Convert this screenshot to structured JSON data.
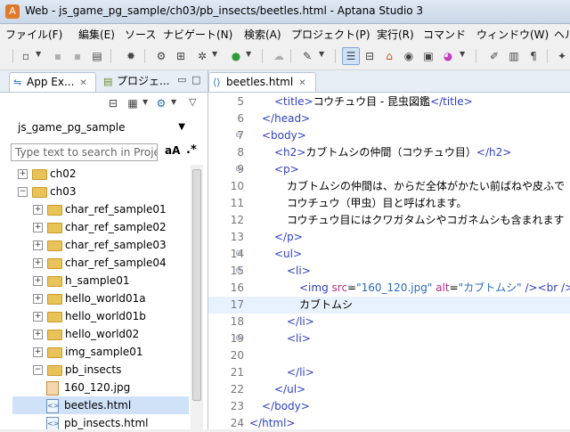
{
  "window": {
    "title": "Web - js_game_pg_sample/ch03/pb_insects/beetles.html - Aptana Studio 3"
  },
  "menu": [
    "ファイル(F)",
    "編集(E)",
    "ソース",
    "ナビゲート(N)",
    "検索(A)",
    "プロジェクト(P)",
    "実行(R)",
    "コマンド",
    "ウィンドウ(W)",
    "ヘル"
  ],
  "left_panel": {
    "tabs": [
      {
        "label": "App Ex..."
      },
      {
        "label": "プロジェ..."
      }
    ],
    "project": "js_game_pg_sample",
    "search_placeholder": "Type text to search in Project",
    "aa_label": "aA",
    "regex_label": ".*",
    "tree": [
      {
        "label": "ch02",
        "type": "folder",
        "level": 0,
        "expander": "+"
      },
      {
        "label": "ch03",
        "type": "folder",
        "level": 0,
        "expander": "−"
      },
      {
        "label": "char_ref_sample01",
        "type": "folder",
        "level": 1,
        "expander": "+"
      },
      {
        "label": "char_ref_sample02",
        "type": "folder",
        "level": 1,
        "expander": "+"
      },
      {
        "label": "char_ref_sample03",
        "type": "folder",
        "level": 1,
        "expander": "+"
      },
      {
        "label": "char_ref_sample04",
        "type": "folder",
        "level": 1,
        "expander": "+"
      },
      {
        "label": "h_sample01",
        "type": "folder",
        "level": 1,
        "expander": "+"
      },
      {
        "label": "hello_world01a",
        "type": "folder",
        "level": 1,
        "expander": "+"
      },
      {
        "label": "hello_world01b",
        "type": "folder",
        "level": 1,
        "expander": "+"
      },
      {
        "label": "hello_world02",
        "type": "folder",
        "level": 1,
        "expander": "+"
      },
      {
        "label": "img_sample01",
        "type": "folder",
        "level": 1,
        "expander": "+"
      },
      {
        "label": "pb_insects",
        "type": "folder",
        "level": 1,
        "expander": "−"
      },
      {
        "label": "160_120.jpg",
        "type": "image",
        "level": 2,
        "expander": ""
      },
      {
        "label": "beetles.html",
        "type": "html",
        "level": 2,
        "expander": "",
        "selected": true
      },
      {
        "label": "pb_insects.html",
        "type": "html",
        "level": 2,
        "expander": ""
      }
    ]
  },
  "editor": {
    "tab_label": "beetles.html",
    "current_line": 17,
    "lines": [
      {
        "n": "5",
        "fold": "",
        "indent": 2,
        "segs": [
          {
            "t": "<title>",
            "c": "tag"
          },
          {
            "t": "コウチュウ目 - 昆虫図鑑",
            "c": "txt"
          },
          {
            "t": "</title>",
            "c": "tag"
          }
        ]
      },
      {
        "n": "6",
        "fold": "",
        "indent": 1,
        "segs": [
          {
            "t": "</head>",
            "c": "tag"
          }
        ]
      },
      {
        "n": "7",
        "fold": "⊖",
        "indent": 1,
        "segs": [
          {
            "t": "<body>",
            "c": "tag"
          }
        ]
      },
      {
        "n": "8",
        "fold": "",
        "indent": 2,
        "segs": [
          {
            "t": "<h2>",
            "c": "tag"
          },
          {
            "t": "カブトムシの仲間（コウチュウ目）",
            "c": "txt"
          },
          {
            "t": "</h2>",
            "c": "tag"
          }
        ]
      },
      {
        "n": "9",
        "fold": "⊖",
        "indent": 2,
        "segs": [
          {
            "t": "<p>",
            "c": "tag"
          }
        ]
      },
      {
        "n": "10",
        "fold": "",
        "indent": 3,
        "segs": [
          {
            "t": "カブトムシの仲間は、からだ全体がかたい前ばねや皮ふで",
            "c": "txt"
          }
        ]
      },
      {
        "n": "11",
        "fold": "",
        "indent": 3,
        "segs": [
          {
            "t": "コウチュウ（甲虫）目と呼ばれます。",
            "c": "txt"
          }
        ]
      },
      {
        "n": "12",
        "fold": "",
        "indent": 3,
        "segs": [
          {
            "t": "コウチュウ目にはクワガタムシやコガネムシも含まれます",
            "c": "txt"
          }
        ]
      },
      {
        "n": "13",
        "fold": "",
        "indent": 2,
        "segs": [
          {
            "t": "</p>",
            "c": "tag"
          }
        ]
      },
      {
        "n": "14",
        "fold": "⊖",
        "indent": 2,
        "segs": [
          {
            "t": "<ul>",
            "c": "tag"
          }
        ]
      },
      {
        "n": "15",
        "fold": "⊖",
        "indent": 3,
        "segs": [
          {
            "t": "<li>",
            "c": "tag"
          }
        ]
      },
      {
        "n": "16",
        "fold": "",
        "indent": 4,
        "segs": [
          {
            "t": "<img ",
            "c": "tag"
          },
          {
            "t": "src",
            "c": "attr"
          },
          {
            "t": "=",
            "c": "txt"
          },
          {
            "t": "\"160_120.jpg\"",
            "c": "val"
          },
          {
            "t": " ",
            "c": "txt"
          },
          {
            "t": "alt",
            "c": "attr"
          },
          {
            "t": "=",
            "c": "txt"
          },
          {
            "t": "\"カブトムシ\"",
            "c": "val"
          },
          {
            "t": " />",
            "c": "tag"
          },
          {
            "t": "<br />",
            "c": "tag"
          }
        ]
      },
      {
        "n": "17",
        "fold": "",
        "indent": 4,
        "segs": [
          {
            "t": "カブトムシ",
            "c": "txt"
          }
        ]
      },
      {
        "n": "18",
        "fold": "",
        "indent": 3,
        "segs": [
          {
            "t": "</li>",
            "c": "tag"
          }
        ]
      },
      {
        "n": "19",
        "fold": "⊖",
        "indent": 3,
        "segs": [
          {
            "t": "<li>",
            "c": "tag"
          }
        ]
      },
      {
        "n": "20",
        "fold": "",
        "indent": 0,
        "segs": []
      },
      {
        "n": "21",
        "fold": "",
        "indent": 3,
        "segs": [
          {
            "t": "</li>",
            "c": "tag"
          }
        ]
      },
      {
        "n": "22",
        "fold": "",
        "indent": 2,
        "segs": [
          {
            "t": "</ul>",
            "c": "tag"
          }
        ]
      },
      {
        "n": "23",
        "fold": "",
        "indent": 1,
        "segs": [
          {
            "t": "</body>",
            "c": "tag"
          }
        ]
      },
      {
        "n": "24",
        "fold": "",
        "indent": 0,
        "segs": [
          {
            "t": "</html>",
            "c": "tag"
          }
        ]
      }
    ]
  },
  "colors": {
    "tag": "#2f3fbf",
    "attr": "#b03080",
    "value": "#2a6ab5",
    "current_line": "#e8f2fe",
    "selection": "#cfe2f7"
  }
}
